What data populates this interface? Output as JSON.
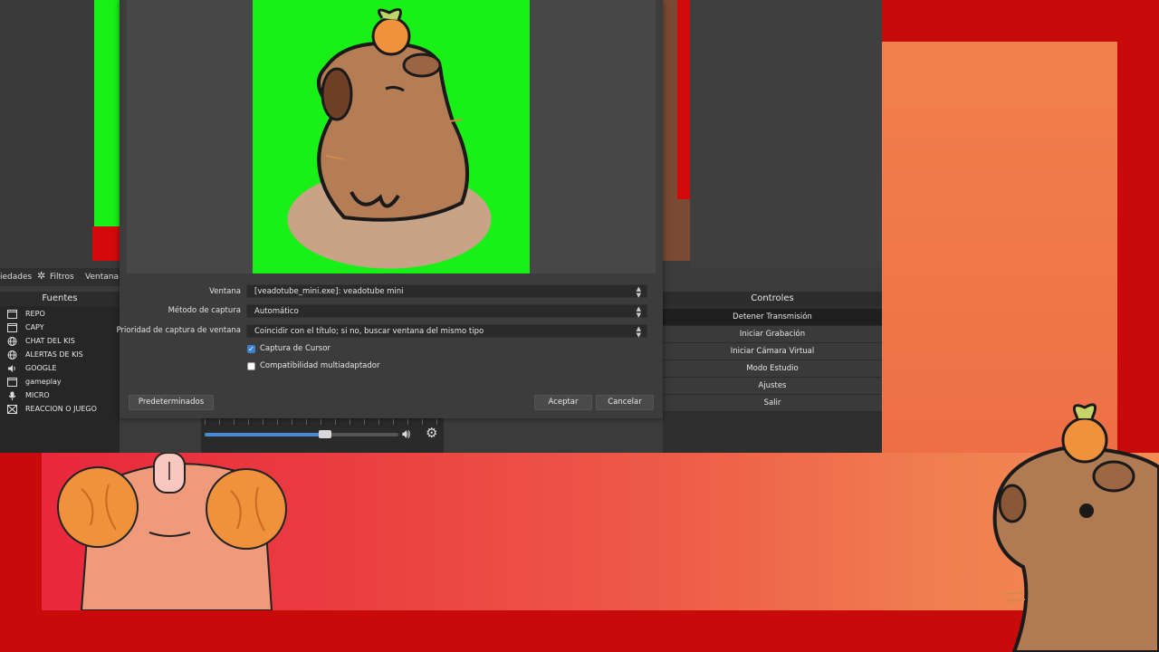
{
  "toolbar": {
    "properties_label": "iedades",
    "filters_label": "Filtros",
    "window_label": "Ventana"
  },
  "sources": {
    "header": "Fuentes",
    "items": [
      {
        "label": "REPO",
        "icon": "window-capture-icon"
      },
      {
        "label": "CAPY",
        "icon": "window-capture-icon"
      },
      {
        "label": "CHAT DEL KIS",
        "icon": "browser-source-icon"
      },
      {
        "label": "ALERTAS DE KIS",
        "icon": "browser-source-icon"
      },
      {
        "label": "GOOGLE",
        "icon": "audio-output-icon"
      },
      {
        "label": "gameplay",
        "icon": "window-capture-icon"
      },
      {
        "label": "MICRO",
        "icon": "microphone-icon"
      },
      {
        "label": "REACCION O JUEGO",
        "icon": "game-capture-icon"
      }
    ]
  },
  "controls": {
    "header": "Controles",
    "buttons": [
      "Detener Transmisión",
      "Iniciar Grabación",
      "Iniciar Cámara Virtual",
      "Modo Estudio",
      "Ajustes",
      "Salir"
    ]
  },
  "mixer": {
    "volume_fraction": 0.62
  },
  "dialog": {
    "window_label": "Ventana",
    "window_value": "[veadotube_mini.exe]: veadotube mini",
    "method_label": "Método de captura",
    "method_value": "Automático",
    "priority_label": "Prioridad de captura de ventana",
    "priority_value": "Coincidir con el título; si no, buscar ventana del mismo tipo",
    "capture_cursor_label": "Captura de Cursor",
    "capture_cursor_checked": true,
    "multiadapter_label": "Compatibilidad multiadaptador",
    "multiadapter_checked": false,
    "defaults_button": "Predeterminados",
    "accept_button": "Aceptar",
    "cancel_button": "Cancelar"
  },
  "colors": {
    "chroma_green": "#18f018",
    "stream_red": "#c70a0a",
    "accent_blue": "#3a82d0"
  }
}
